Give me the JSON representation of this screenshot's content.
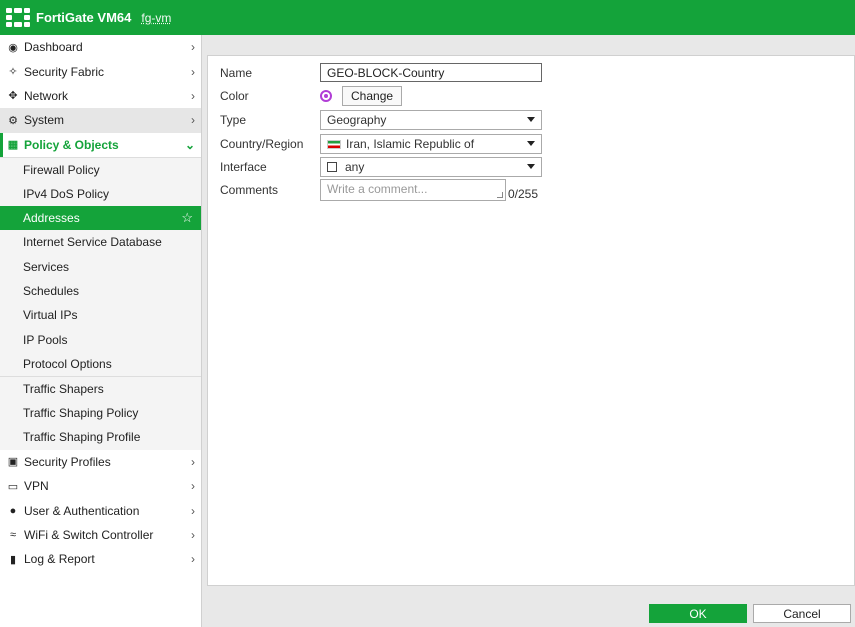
{
  "header": {
    "product": "FortiGate VM64",
    "hostname": "fg-vm"
  },
  "sidebar": {
    "top_items": [
      {
        "label": "Dashboard",
        "icon": "dashboard-icon"
      },
      {
        "label": "Security Fabric",
        "icon": "security-fabric-icon"
      },
      {
        "label": "Network",
        "icon": "network-icon"
      },
      {
        "label": "System",
        "icon": "gear-icon"
      },
      {
        "label": "Policy & Objects",
        "icon": "policy-icon"
      }
    ],
    "sub_items": [
      {
        "label": "Firewall Policy"
      },
      {
        "label": "IPv4 DoS Policy"
      },
      {
        "label": "Addresses"
      },
      {
        "label": "Internet Service Database"
      },
      {
        "label": "Services"
      },
      {
        "label": "Schedules"
      },
      {
        "label": "Virtual IPs"
      },
      {
        "label": "IP Pools"
      },
      {
        "label": "Protocol Options"
      },
      {
        "label": "Traffic Shapers"
      },
      {
        "label": "Traffic Shaping Policy"
      },
      {
        "label": "Traffic Shaping Profile"
      }
    ],
    "bottom_items": [
      {
        "label": "Security Profiles",
        "icon": "lock-icon"
      },
      {
        "label": "VPN",
        "icon": "laptop-icon"
      },
      {
        "label": "User & Authentication",
        "icon": "user-icon"
      },
      {
        "label": "WiFi & Switch Controller",
        "icon": "wifi-icon"
      },
      {
        "label": "Log & Report",
        "icon": "chart-icon"
      }
    ]
  },
  "form": {
    "name_label": "Name",
    "name_value": "GEO-BLOCK-Country",
    "color_label": "Color",
    "color_button": "Change",
    "type_label": "Type",
    "type_value": "Geography",
    "country_label": "Country/Region",
    "country_value": "Iran, Islamic Republic of",
    "interface_label": "Interface",
    "interface_value": "any",
    "comments_label": "Comments",
    "comments_placeholder": "Write a comment...",
    "comments_counter": "0/255"
  },
  "footer": {
    "ok_label": "OK",
    "cancel_label": "Cancel"
  },
  "colors": {
    "accent": "#14a33a",
    "address_color": "#b13ed6"
  }
}
